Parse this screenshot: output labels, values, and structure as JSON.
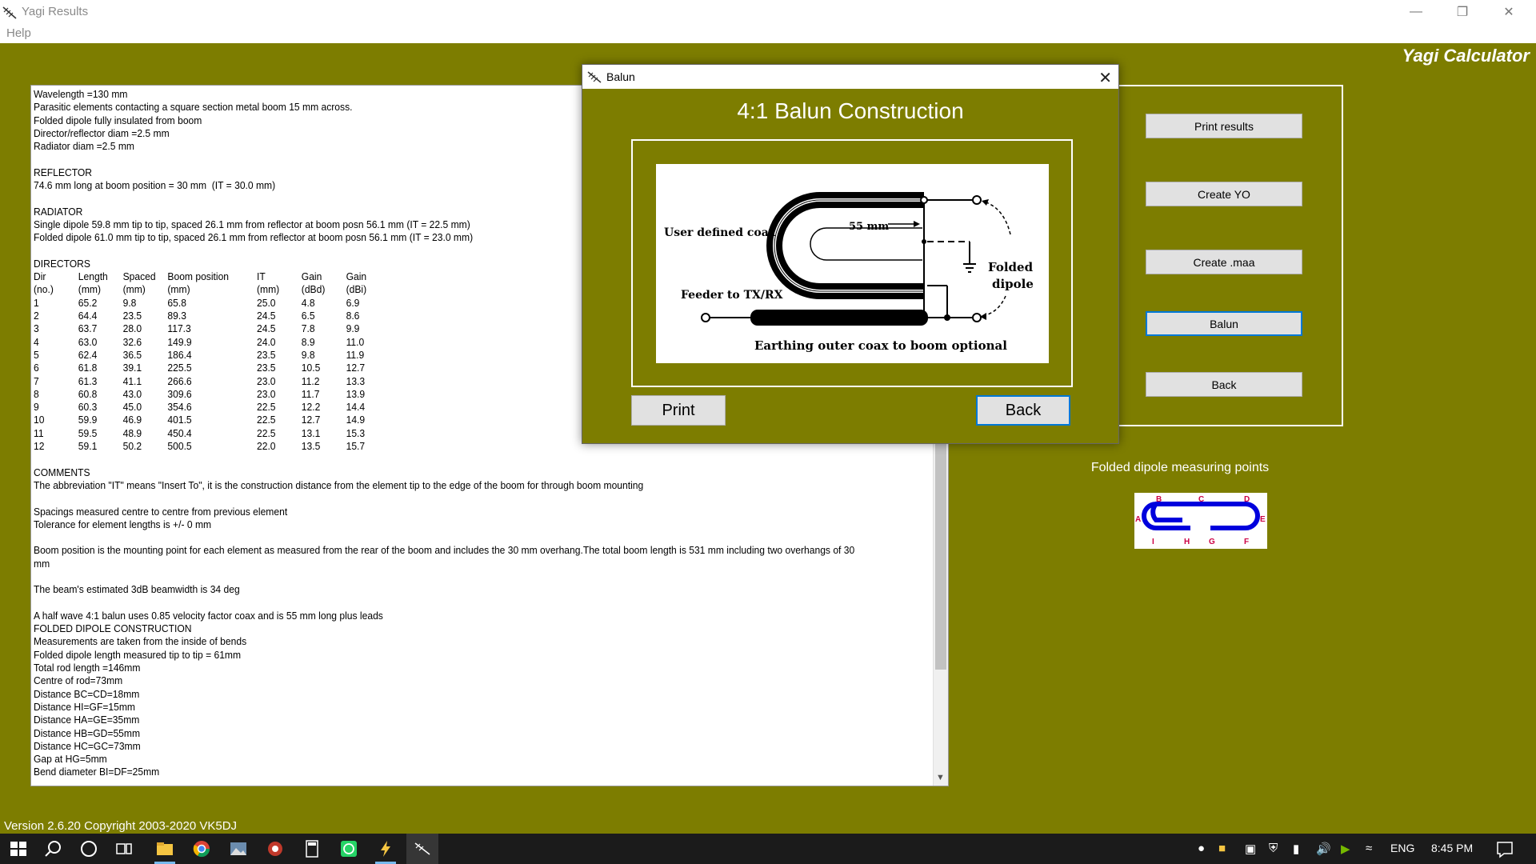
{
  "window": {
    "title": "Yagi Results",
    "menu": [
      "Help"
    ],
    "brand": "Yagi Calculator",
    "version": "Version 2.6.20  Copyright 2003-2020 VK5DJ"
  },
  "results_lines": [
    "Wavelength =130 mm",
    "Parasitic elements contacting a square section metal boom 15 mm across.",
    "Folded dipole fully insulated from boom",
    "Director/reflector diam =2.5 mm",
    "Radiator diam =2.5 mm",
    "",
    "REFLECTOR",
    "74.6 mm long at boom position = 30 mm  (IT = 30.0 mm)",
    "",
    "RADIATOR",
    "Single dipole 59.8 mm tip to tip, spaced 26.1 mm from reflector at boom posn 56.1 mm (IT = 22.5 mm)",
    "Folded dipole 61.0 mm tip to tip, spaced 26.1 mm from reflector at boom posn 56.1 mm (IT = 23.0 mm)",
    "",
    "DIRECTORS"
  ],
  "directors_table": {
    "headers": [
      [
        "Dir",
        "Length",
        "Spaced",
        "Boom position",
        "IT",
        "Gain",
        "Gain"
      ],
      [
        "(no.)",
        "(mm)",
        "(mm)",
        "(mm)",
        "(mm)",
        "(dBd)",
        "(dBi)"
      ]
    ],
    "rows": [
      [
        "1",
        "65.2",
        "9.8",
        "65.8",
        "25.0",
        "4.8",
        "6.9"
      ],
      [
        "2",
        "64.4",
        "23.5",
        "89.3",
        "24.5",
        "6.5",
        "8.6"
      ],
      [
        "3",
        "63.7",
        "28.0",
        "117.3",
        "24.5",
        "7.8",
        "9.9"
      ],
      [
        "4",
        "63.0",
        "32.6",
        "149.9",
        "24.0",
        "8.9",
        "11.0"
      ],
      [
        "5",
        "62.4",
        "36.5",
        "186.4",
        "23.5",
        "9.8",
        "11.9"
      ],
      [
        "6",
        "61.8",
        "39.1",
        "225.5",
        "23.5",
        "10.5",
        "12.7"
      ],
      [
        "7",
        "61.3",
        "41.1",
        "266.6",
        "23.0",
        "11.2",
        "13.3"
      ],
      [
        "8",
        "60.8",
        "43.0",
        "309.6",
        "23.0",
        "11.7",
        "13.9"
      ],
      [
        "9",
        "60.3",
        "45.0",
        "354.6",
        "22.5",
        "12.2",
        "14.4"
      ],
      [
        "10",
        "59.9",
        "46.9",
        "401.5",
        "22.5",
        "12.7",
        "14.9"
      ],
      [
        "11",
        "59.5",
        "48.9",
        "450.4",
        "22.5",
        "13.1",
        "15.3"
      ],
      [
        "12",
        "59.1",
        "50.2",
        "500.5",
        "22.0",
        "13.5",
        "15.7"
      ]
    ]
  },
  "comments_lines": [
    "COMMENTS",
    "The abbreviation \"IT\" means \"Insert To\", it is the construction distance from the element tip to the edge of the boom for through boom mounting",
    "",
    "Spacings measured centre to centre from previous element",
    "Tolerance for element lengths is +/- 0 mm",
    "",
    "Boom position is the mounting point for each element as measured from the rear of the boom and includes the 30 mm overhang.The total boom length is 531 mm including two overhangs of 30",
    "mm",
    "",
    "The beam's estimated 3dB beamwidth is 34 deg",
    "",
    "A half wave 4:1 balun uses 0.85 velocity factor coax and is 55 mm long plus leads",
    "FOLDED DIPOLE CONSTRUCTION",
    "Measurements are taken from the inside of bends",
    "Folded dipole length measured tip to tip = 61mm",
    "Total rod length =146mm",
    "Centre of rod=73mm",
    "Distance BC=CD=18mm",
    "Distance HI=GF=15mm",
    "Distance HA=GE=35mm",
    "Distance HB=GD=55mm",
    "Distance HC=GC=73mm",
    "Gap at HG=5mm",
    "Bend diameter BI=DF=25mm"
  ],
  "side_buttons": [
    "Print results",
    "Create YO",
    "Create .maa",
    "Balun",
    "Back"
  ],
  "folded_dipole": {
    "caption": "Folded dipole measuring points",
    "letters_top": [
      "B",
      "C",
      "D"
    ],
    "letters_bottom": [
      "I",
      "H",
      "G",
      "F"
    ],
    "letter_left": "A",
    "letter_right": "E"
  },
  "dialog": {
    "title": "Balun",
    "heading": "4:1 Balun Construction",
    "print_label": "Print",
    "back_label": "Back",
    "diagram": {
      "user_coax": "User defined coax",
      "length": "55 mm",
      "feeder": "Feeder to TX/RX",
      "folded": "Folded",
      "dipole": "dipole",
      "earthing": "Earthing outer coax to boom optional"
    }
  },
  "taskbar": {
    "lang": "ENG",
    "time": "8:45 PM"
  },
  "colors": {
    "background": "#7d7d00",
    "focus": "#0078d7",
    "dipole_blue": "#0000dd",
    "dipole_letters": "#cc0044"
  }
}
